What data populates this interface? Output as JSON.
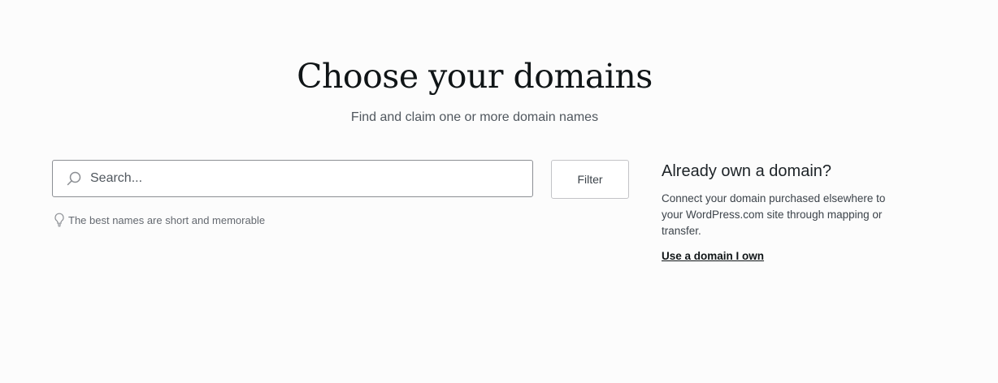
{
  "header": {
    "title": "Choose your domains",
    "subtitle": "Find and claim one or more domain names"
  },
  "search": {
    "placeholder": "Search...",
    "value": "",
    "icon": "search-icon"
  },
  "filter": {
    "label": "Filter"
  },
  "hint": {
    "icon": "lightbulb-icon",
    "text": "The best names are short and memorable"
  },
  "own_domain": {
    "heading": "Already own a domain?",
    "description": "Connect your domain purchased elsewhere to your WordPress.com site through mapping or transfer.",
    "link_label": "Use a domain I own"
  }
}
